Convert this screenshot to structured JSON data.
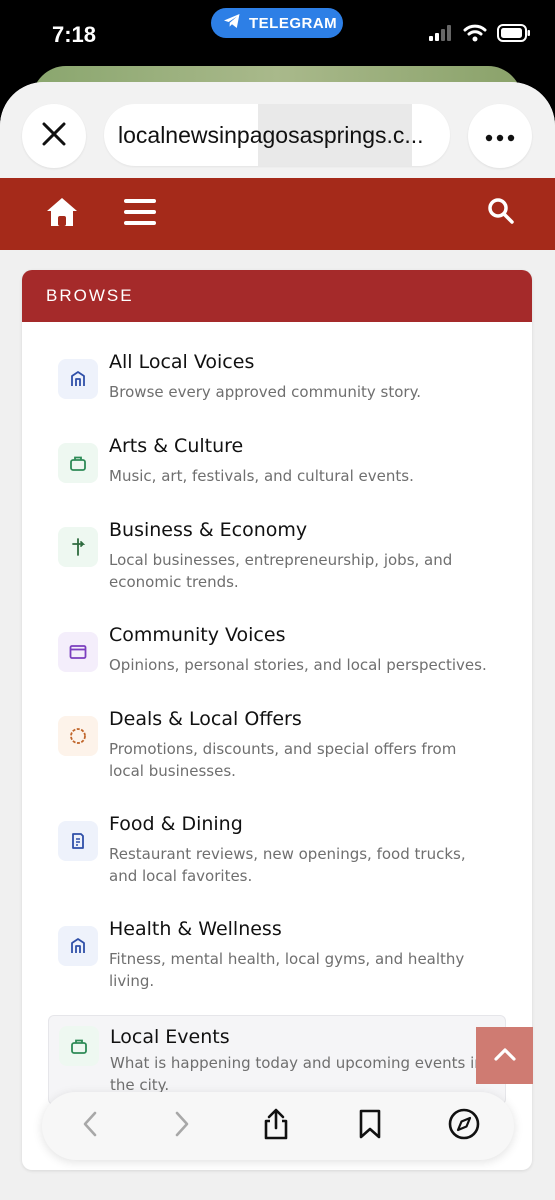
{
  "status_bar": {
    "time": "7:18",
    "back_app_label": "TELEGRAM"
  },
  "browser": {
    "url": "localnewsinpagosasprings.c...",
    "close_icon": "close-icon",
    "more_icon": "more-icon"
  },
  "site_header": {
    "color": "#a52a1a",
    "icons": [
      "home-icon",
      "menu-icon",
      "search-icon"
    ]
  },
  "browse": {
    "heading": "BROWSE",
    "items": [
      {
        "title": "All Local Voices",
        "desc": "Browse every approved community story.",
        "icon": "building-icon",
        "color": "#2f4fa8",
        "bg": "#eef2fb"
      },
      {
        "title": "Arts & Culture",
        "desc": "Music, art, festivals, and cultural events.",
        "icon": "bag-icon",
        "color": "#2e8b57",
        "bg": "#eef8f1"
      },
      {
        "title": "Business & Economy",
        "desc": "Local businesses, entrepreneurship, jobs, and economic trends.",
        "icon": "signpost-icon",
        "color": "#2e6b3f",
        "bg": "#eef8f1"
      },
      {
        "title": "Community Voices",
        "desc": "Opinions, personal stories, and local perspectives.",
        "icon": "window-icon",
        "color": "#7b3fbf",
        "bg": "#f4eefb"
      },
      {
        "title": "Deals & Local Offers",
        "desc": "Promotions, discounts, and special offers from local businesses.",
        "icon": "circle-icon",
        "color": "#c0652a",
        "bg": "#fdf3ea"
      },
      {
        "title": "Food & Dining",
        "desc": "Restaurant reviews, new openings, food trucks, and local favorites.",
        "icon": "menu-card-icon",
        "color": "#2f4fa8",
        "bg": "#eef2fb"
      },
      {
        "title": "Health & Wellness",
        "desc": "Fitness, mental health, local gyms, and healthy living.",
        "icon": "building-icon",
        "color": "#2f4fa8",
        "bg": "#eef2fb"
      },
      {
        "title": "Local Events",
        "desc": "What is happening today and upcoming events in the city.",
        "icon": "bag-icon",
        "color": "#2e8b57",
        "bg": "#eef8f1"
      }
    ]
  },
  "bottom_bar": {
    "icons": [
      "back-icon",
      "forward-icon",
      "share-icon",
      "bookmarks-icon",
      "compass-icon"
    ]
  }
}
